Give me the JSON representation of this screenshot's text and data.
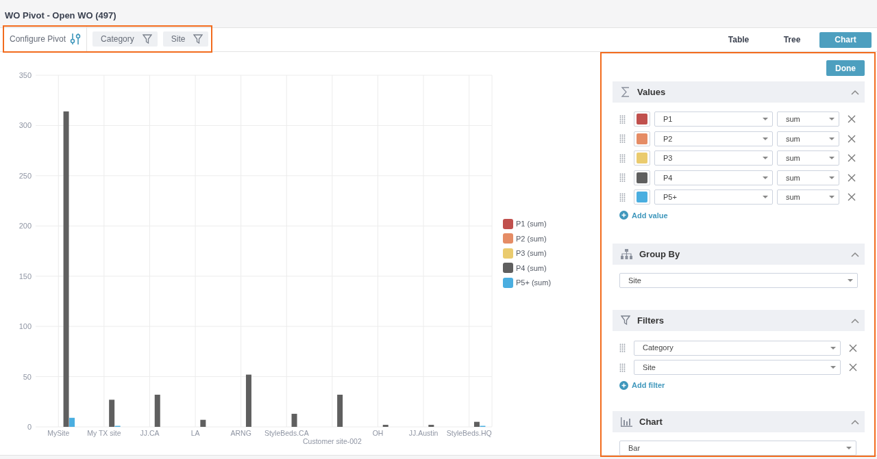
{
  "title": "WO Pivot - Open WO (497)",
  "toolbar": {
    "configure_label": "Configure Pivot",
    "filter_chips": [
      {
        "label": "Category"
      },
      {
        "label": "Site"
      }
    ]
  },
  "view_tabs": [
    {
      "label": "Table",
      "selected": false
    },
    {
      "label": "Tree",
      "selected": false
    },
    {
      "label": "Chart",
      "selected": true
    }
  ],
  "chart_data": {
    "type": "bar",
    "categories": [
      "MySite",
      "My TX site",
      "JJ.CA",
      "LA",
      "ARNG",
      "StyleBeds.CA",
      "Customer site-002",
      "OH",
      "JJ.Austin",
      "StyleBeds.HQ"
    ],
    "series": [
      {
        "name": "P1 (sum)",
        "color": "#c0504d",
        "values": [
          0,
          0,
          0,
          0,
          0,
          0,
          0,
          0,
          0,
          0
        ]
      },
      {
        "name": "P2 (sum)",
        "color": "#e58c65",
        "values": [
          0,
          0,
          0,
          0,
          0,
          0,
          0,
          0,
          0,
          0
        ]
      },
      {
        "name": "P3 (sum)",
        "color": "#eacb6e",
        "values": [
          0,
          0,
          0,
          0,
          0,
          0,
          0,
          0,
          0,
          0
        ]
      },
      {
        "name": "P4 (sum)",
        "color": "#5f5f5f",
        "values": [
          314,
          27,
          32,
          7,
          52,
          13,
          32,
          2,
          2,
          5
        ]
      },
      {
        "name": "P5+ (sum)",
        "color": "#4aaee0",
        "values": [
          9,
          1,
          0,
          0,
          0,
          0,
          0,
          0,
          0,
          1
        ]
      }
    ],
    "grid": true,
    "ylim": [
      0,
      350
    ],
    "yticks": [
      0,
      50,
      100,
      150,
      200,
      250,
      300,
      350
    ]
  },
  "panel": {
    "done_label": "Done",
    "values": {
      "title": "Values",
      "expanded": true,
      "items": [
        {
          "color": "#c0504d",
          "field": "P1",
          "aggregation": "sum"
        },
        {
          "color": "#e58c65",
          "field": "P2",
          "aggregation": "sum"
        },
        {
          "color": "#eacb6e",
          "field": "P3",
          "aggregation": "sum"
        },
        {
          "color": "#5f5f5f",
          "field": "P4",
          "aggregation": "sum"
        },
        {
          "color": "#4aaee0",
          "field": "P5+",
          "aggregation": "sum"
        }
      ],
      "add_label": "Add value"
    },
    "group_by": {
      "title": "Group By",
      "expanded": true,
      "value": "Site"
    },
    "filters": {
      "title": "Filters",
      "expanded": true,
      "items": [
        {
          "field": "Category"
        },
        {
          "field": "Site"
        }
      ],
      "add_label": "Add filter"
    },
    "chart": {
      "title": "Chart",
      "expanded": true,
      "value": "Bar"
    }
  }
}
